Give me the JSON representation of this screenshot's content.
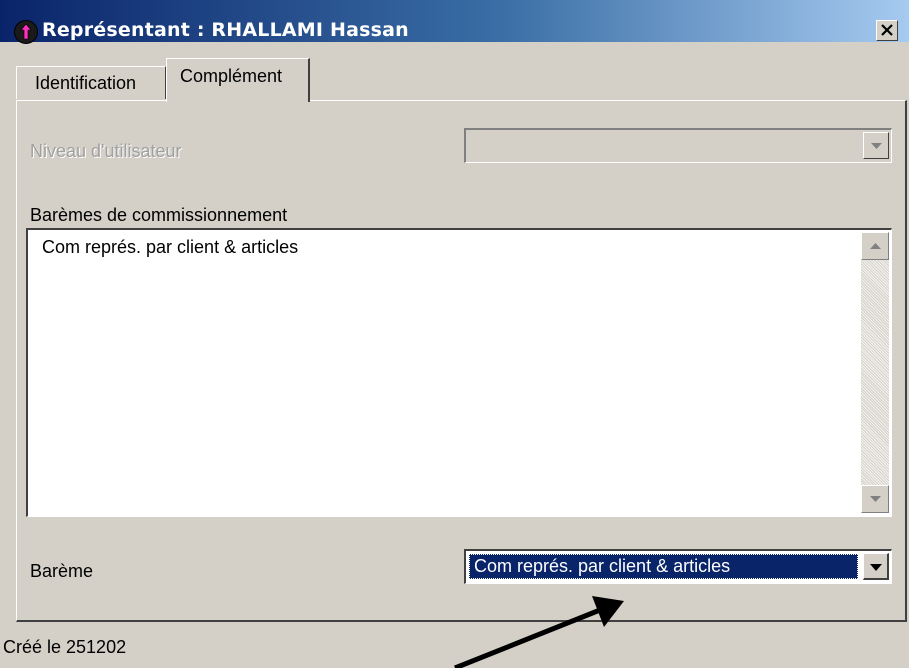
{
  "window": {
    "title": "Représentant : RHALLAMI Hassan",
    "close_label": "×"
  },
  "tabs": [
    {
      "label": "Identification",
      "selected": false
    },
    {
      "label": "Complément",
      "selected": true
    }
  ],
  "form": {
    "niveau_label": "Niveau d'utilisateur",
    "niveau_value": "",
    "baremes_label": "Barèmes de commissionnement",
    "baremes_items": [
      "Com représ. par client & articles"
    ],
    "bareme_label": "Barème",
    "bareme_value": "Com représ. par client & articles"
  },
  "status": {
    "created": "Créé le 251202"
  },
  "colors": {
    "face": "#d4d0c8",
    "title_start": "#0a246a",
    "title_end": "#a6caf0",
    "selection": "#0a246a",
    "disabled_text": "#a0a0a0"
  },
  "icons": {
    "app": "pink-up-arrow-icon",
    "close": "close-icon",
    "dropdown": "chevron-down-icon",
    "scroll_up": "scroll-up-icon",
    "scroll_down": "scroll-down-icon",
    "annotation": "pointer-arrow"
  }
}
